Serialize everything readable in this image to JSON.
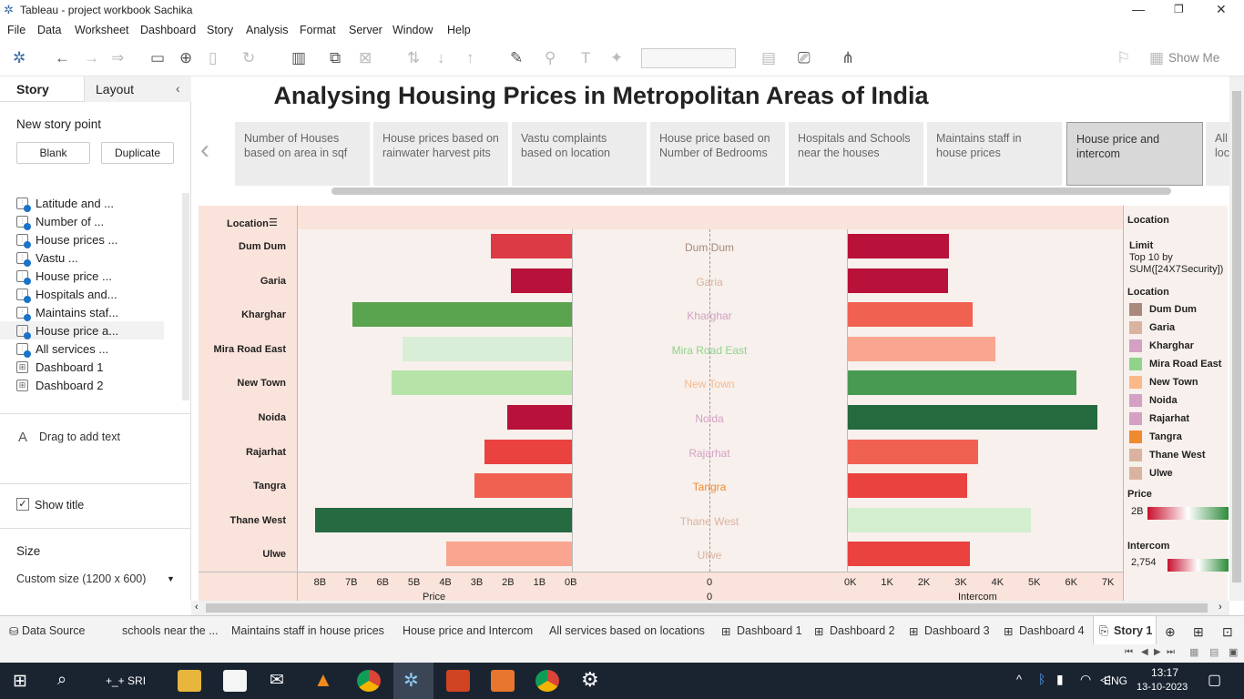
{
  "window": {
    "title": "Tableau - project workbook Sachika"
  },
  "menu": [
    "File",
    "Data",
    "Worksheet",
    "Dashboard",
    "Story",
    "Analysis",
    "Format",
    "Server",
    "Window",
    "Help"
  ],
  "toolbar": {
    "show_me": "Show Me"
  },
  "left_pane": {
    "tabs": [
      "Story",
      "Layout"
    ],
    "new_story_point": "New story point",
    "blank_button": "Blank",
    "duplicate_button": "Duplicate",
    "sheets": [
      "Latitude and ...",
      "Number of ...",
      "House prices ...",
      "Vastu ...",
      "House price ...",
      "Hospitals and...",
      "Maintains staf...",
      "House price a...",
      "All services ...",
      "Dashboard 1",
      "Dashboard 2"
    ],
    "drag_text": "Drag to add text",
    "show_title": "Show title",
    "size_label": "Size",
    "size_value": "Custom size (1200 x 600)"
  },
  "story": {
    "title": "Analysing Housing Prices in Metropolitan Areas of India",
    "points": [
      "Number of Houses based on area in sqf",
      "House prices based on rainwater harvest pits",
      "Vastu complaints based on location",
      "House price based on Number of Bedrooms",
      "Hospitals and Schools near the houses",
      "Maintains staff in house prices",
      "House price and intercom",
      "All services based on locations"
    ]
  },
  "chart_data": {
    "type": "bar",
    "row_header": "Location",
    "categories": [
      "Dum Dum",
      "Garia",
      "Kharghar",
      "Mira Road East",
      "New Town",
      "Noida",
      "Rajarhat",
      "Tangra",
      "Thane West",
      "Ulwe"
    ],
    "category_colors": [
      "#a8897a",
      "#d9b39f",
      "#d4a0c4",
      "#8fd48a",
      "#f9b98a",
      "#d4a0c4",
      "#d4a0c4",
      "#f08a2e",
      "#d9b39f",
      "#d9b39f"
    ],
    "series": [
      {
        "name": "Price",
        "values": [
          2.6,
          1.95,
          7.0,
          5.4,
          5.75,
          2.05,
          2.8,
          3.1,
          8.2,
          4.0
        ],
        "colors": [
          "#dc3a44",
          "#b8113a",
          "#5aa34f",
          "#d9eed6",
          "#b6e3a8",
          "#b8113a",
          "#e9423f",
          "#f06151",
          "#256a40",
          "#f9a58f"
        ]
      },
      {
        "name": "Intercom",
        "values": [
          2754,
          2720,
          3400,
          4020,
          6200,
          6780,
          3540,
          3250,
          4980,
          3320
        ],
        "colors": [
          "#b8113a",
          "#b8113a",
          "#f06151",
          "#f9a58f",
          "#489a52",
          "#246a3e",
          "#f06151",
          "#e9423f",
          "#d4eed0",
          "#e9423f"
        ]
      }
    ],
    "price_axis": {
      "label": "Price",
      "ticks": [
        "8B",
        "7B",
        "6B",
        "5B",
        "4B",
        "3B",
        "2B",
        "1B",
        "0B"
      ],
      "range": [
        0,
        8.6
      ]
    },
    "center_axis": {
      "ticks": [
        "0"
      ],
      "label": "0"
    },
    "intercom_axis": {
      "label": "Intercom",
      "ticks": [
        "0K",
        "1K",
        "2K",
        "3K",
        "4K",
        "5K",
        "6K",
        "7K"
      ],
      "range": [
        0,
        7300
      ]
    },
    "legend": {
      "location_title": "Location",
      "limit_title": "Limit",
      "limit_text_1": "Top 10 by",
      "limit_text_2": "SUM([24X7Security])",
      "color_title": "Location",
      "price_title": "Price",
      "price_value": "2B",
      "intercom_title": "Intercom",
      "intercom_value": "2,754"
    }
  },
  "sheet_tabs": [
    "Data Source",
    "schools near the ...",
    "Maintains staff in house prices",
    "House price and Intercom",
    "All services based on locations",
    "Dashboard 1",
    "Dashboard 2",
    "Dashboard 3",
    "Dashboard 4",
    "Story 1"
  ],
  "taskbar": {
    "search_text": "+_+ SRI",
    "lang": "ENG",
    "time": "13:17",
    "date": "13-10-2023"
  }
}
